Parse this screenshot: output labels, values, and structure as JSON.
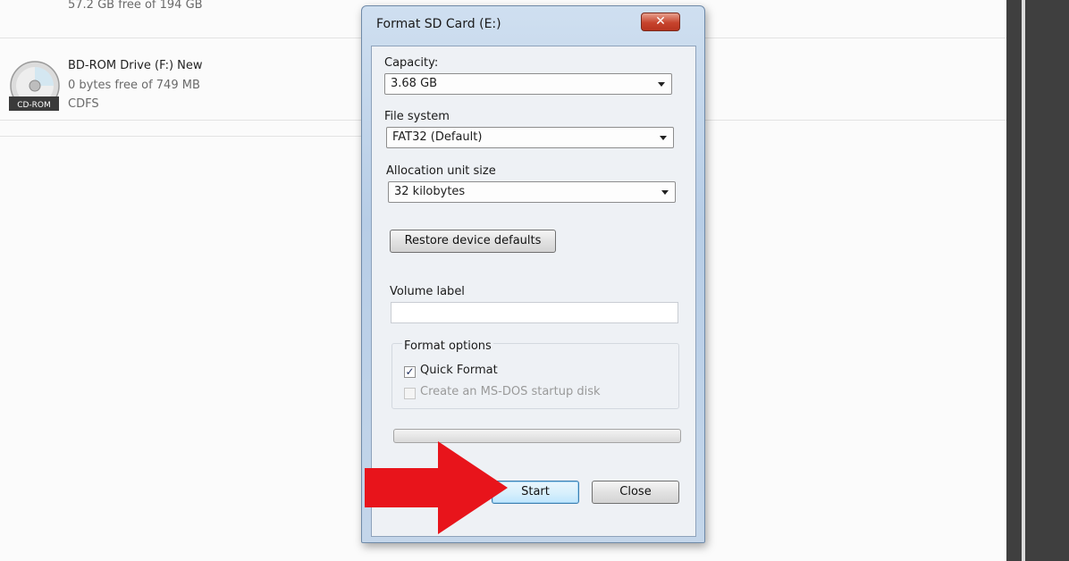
{
  "explorer": {
    "drive_partial_free": "57.2 GB free of 194 GB",
    "bd_drive": {
      "name": "BD-ROM Drive (F:) New",
      "free": "0 bytes free of 749 MB",
      "fs": "CDFS",
      "icon_label": "CD-ROM"
    }
  },
  "dialog": {
    "title": "Format SD Card (E:)",
    "close_glyph": "✕",
    "capacity_label": "Capacity:",
    "capacity_value": "3.68 GB",
    "filesystem_label": "File system",
    "filesystem_value": "FAT32 (Default)",
    "allocation_label": "Allocation unit size",
    "allocation_value": "32 kilobytes",
    "restore_button": "Restore device defaults",
    "volume_label": "Volume label",
    "volume_value": "",
    "format_options_label": "Format options",
    "quick_format_label": "Quick Format",
    "quick_format_checked": true,
    "msdos_label": "Create an MS-DOS startup disk",
    "msdos_checked": false,
    "msdos_enabled": false,
    "progress": 0,
    "start_button": "Start",
    "close_button": "Close",
    "checkmark_glyph": "✓"
  },
  "annotation": {
    "arrow_color": "#e8141b"
  }
}
